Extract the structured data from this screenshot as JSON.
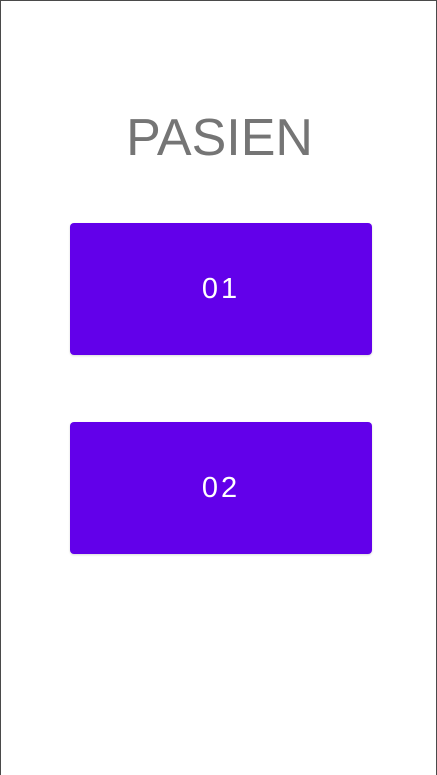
{
  "screen": {
    "title": "PASIEN"
  },
  "buttons": [
    {
      "label": "01"
    },
    {
      "label": "02"
    }
  ],
  "colors": {
    "accent": "#6200ea",
    "title_text": "#757575",
    "button_text": "#ffffff",
    "background": "#ffffff"
  }
}
